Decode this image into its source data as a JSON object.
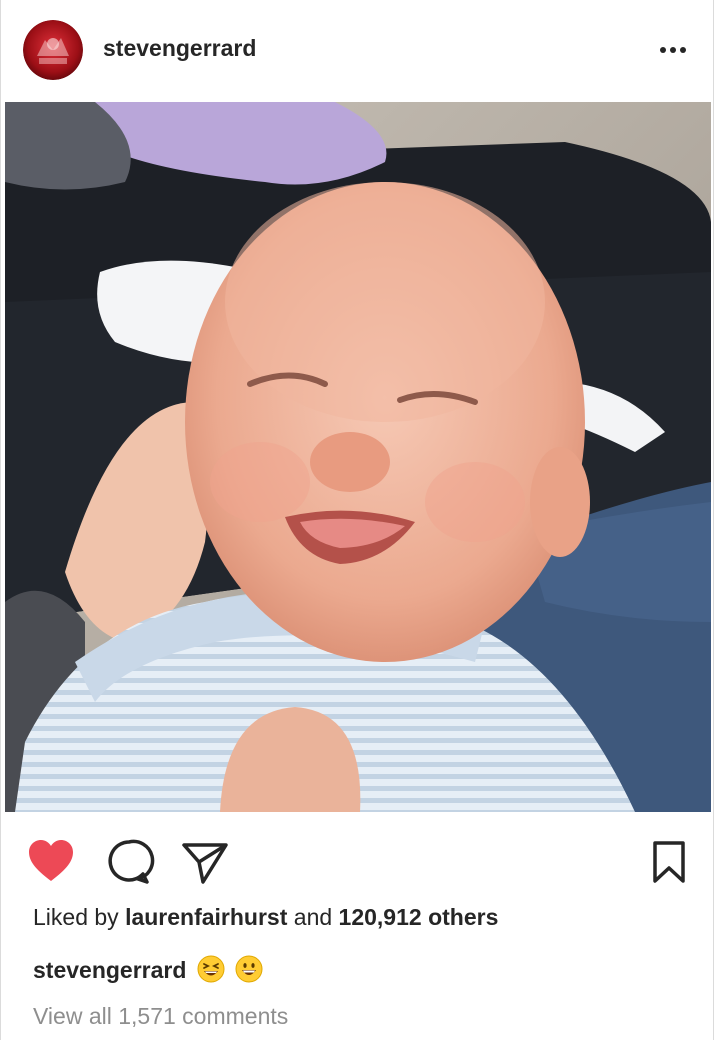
{
  "post": {
    "username": "stevengerrard",
    "likes": {
      "prefix": "Liked by",
      "user": "laurenfairhurst",
      "middle": "and",
      "count": "120,912 others"
    },
    "caption": {
      "username": "stevengerrard",
      "emojis": [
        "grinning-squinting-face",
        "grinning-face"
      ]
    },
    "comments_link": "View all 1,571 comments",
    "liked": true
  },
  "icons": {
    "like": "heart-filled-icon",
    "comment": "comment-icon",
    "share": "direct-share-icon",
    "save": "bookmark-icon",
    "more": "ellipsis-icon"
  },
  "colors": {
    "like_red": "#ed4956",
    "text": "#262626",
    "secondary_text": "#8e8e8e",
    "border": "#dbdbdb"
  }
}
